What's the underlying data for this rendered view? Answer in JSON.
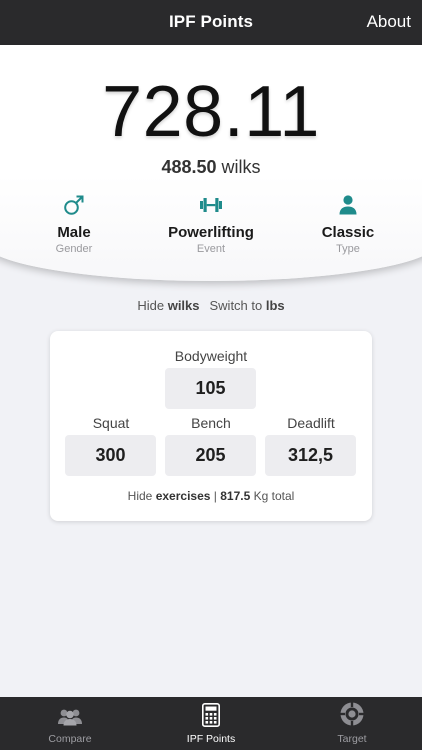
{
  "nav": {
    "title": "IPF Points",
    "about_label": "About"
  },
  "result": {
    "score": "728.11",
    "wilks_value": "488.50",
    "wilks_unit": "wilks"
  },
  "options": [
    {
      "value": "Male",
      "caption": "Gender",
      "icon": "male-icon"
    },
    {
      "value": "Powerlifting",
      "caption": "Event",
      "icon": "dumbbell-icon"
    },
    {
      "value": "Classic",
      "caption": "Type",
      "icon": "person-icon"
    }
  ],
  "toggles": {
    "hide_prefix": "Hide",
    "hide_target": "wilks",
    "switch_prefix": "Switch to",
    "switch_target": "lbs"
  },
  "inputs": {
    "bodyweight": {
      "label": "Bodyweight",
      "value": "105"
    },
    "squat": {
      "label": "Squat",
      "value": "300"
    },
    "bench": {
      "label": "Bench",
      "value": "205"
    },
    "deadlift": {
      "label": "Deadlift",
      "value": "312,5"
    }
  },
  "total": {
    "hide_prefix": "Hide",
    "hide_target": "exercises",
    "separator": "|",
    "value": "817.5",
    "unit_suffix": "Kg total"
  },
  "tabs": [
    {
      "label": "Compare",
      "icon": "users-icon",
      "active": false
    },
    {
      "label": "IPF Points",
      "icon": "calculator-icon",
      "active": true
    },
    {
      "label": "Target",
      "icon": "target-icon",
      "active": false
    }
  ],
  "colors": {
    "accent": "#1f8b8b",
    "nav_bg": "#2a2a2c",
    "page_bg": "#f1f2f6"
  }
}
